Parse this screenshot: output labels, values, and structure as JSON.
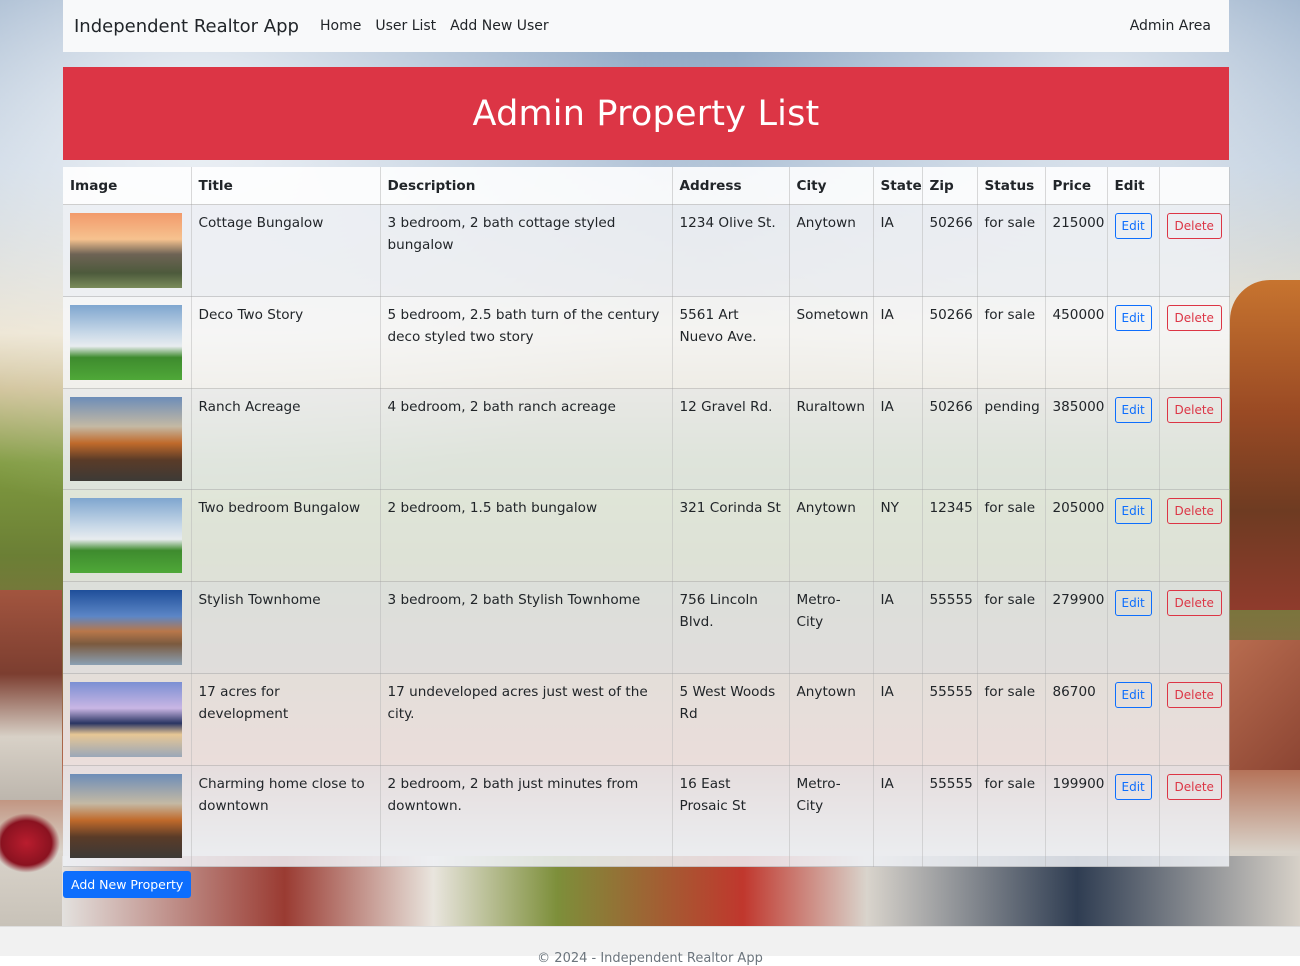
{
  "nav": {
    "brand": "Independent Realtor App",
    "links": [
      "Home",
      "User List",
      "Add New User"
    ],
    "right": "Admin Area"
  },
  "banner": {
    "title": "Admin Property List"
  },
  "table": {
    "headers": [
      "Image",
      "Title",
      "Description",
      "Address",
      "City",
      "State",
      "Zip",
      "Status",
      "Price",
      "Edit",
      ""
    ],
    "edit_label": "Edit",
    "delete_label": "Delete",
    "rows": [
      {
        "image": "house-photo",
        "title": "Cottage Bungalow",
        "description": "3 bedroom, 2 bath cottage styled bungalow",
        "address": "1234 Olive St.",
        "city": "Anytown",
        "state": "IA",
        "zip": "50266",
        "status": "for sale",
        "price": "215000"
      },
      {
        "image": "house-photo",
        "title": "Deco Two Story",
        "description": "5 bedroom, 2.5 bath turn of the century deco styled two story",
        "address": "5561 Art Nuevo Ave.",
        "city": "Sometown",
        "state": "IA",
        "zip": "50266",
        "status": "for sale",
        "price": "450000"
      },
      {
        "image": "house-photo",
        "title": "Ranch Acreage",
        "description": "4 bedroom, 2 bath ranch acreage",
        "address": "12 Gravel Rd.",
        "city": "Ruraltown",
        "state": "IA",
        "zip": "50266",
        "status": "pending",
        "price": "385000"
      },
      {
        "image": "house-photo",
        "title": "Two bedroom Bungalow",
        "description": "2 bedroom, 1.5 bath bungalow",
        "address": "321 Corinda St",
        "city": "Anytown",
        "state": "NY",
        "zip": "12345",
        "status": "for sale",
        "price": "205000"
      },
      {
        "image": "house-photo",
        "title": "Stylish Townhome",
        "description": "3 bedroom, 2 bath Stylish Townhome",
        "address": "756 Lincoln Blvd.",
        "city": "Metro-City",
        "state": "IA",
        "zip": "55555",
        "status": "for sale",
        "price": "279900"
      },
      {
        "image": "house-photo",
        "title": "17 acres for development",
        "description": "17 undeveloped acres just west of the city.",
        "address": "5 West Woods Rd",
        "city": "Anytown",
        "state": "IA",
        "zip": "55555",
        "status": "for sale",
        "price": "86700"
      },
      {
        "image": "house-photo",
        "title": "Charming home close to downtown",
        "description": "2 bedroom, 2 bath just minutes from downtown.",
        "address": "16 East Prosaic St",
        "city": "Metro-City",
        "state": "IA",
        "zip": "55555",
        "status": "for sale",
        "price": "199900"
      }
    ]
  },
  "add_button": "Add New Property",
  "footer": "© 2024 - Independent Realtor App",
  "colors": {
    "primary": "#0d6efd",
    "danger": "#dc3545",
    "navbar": "#f8f9fa"
  }
}
